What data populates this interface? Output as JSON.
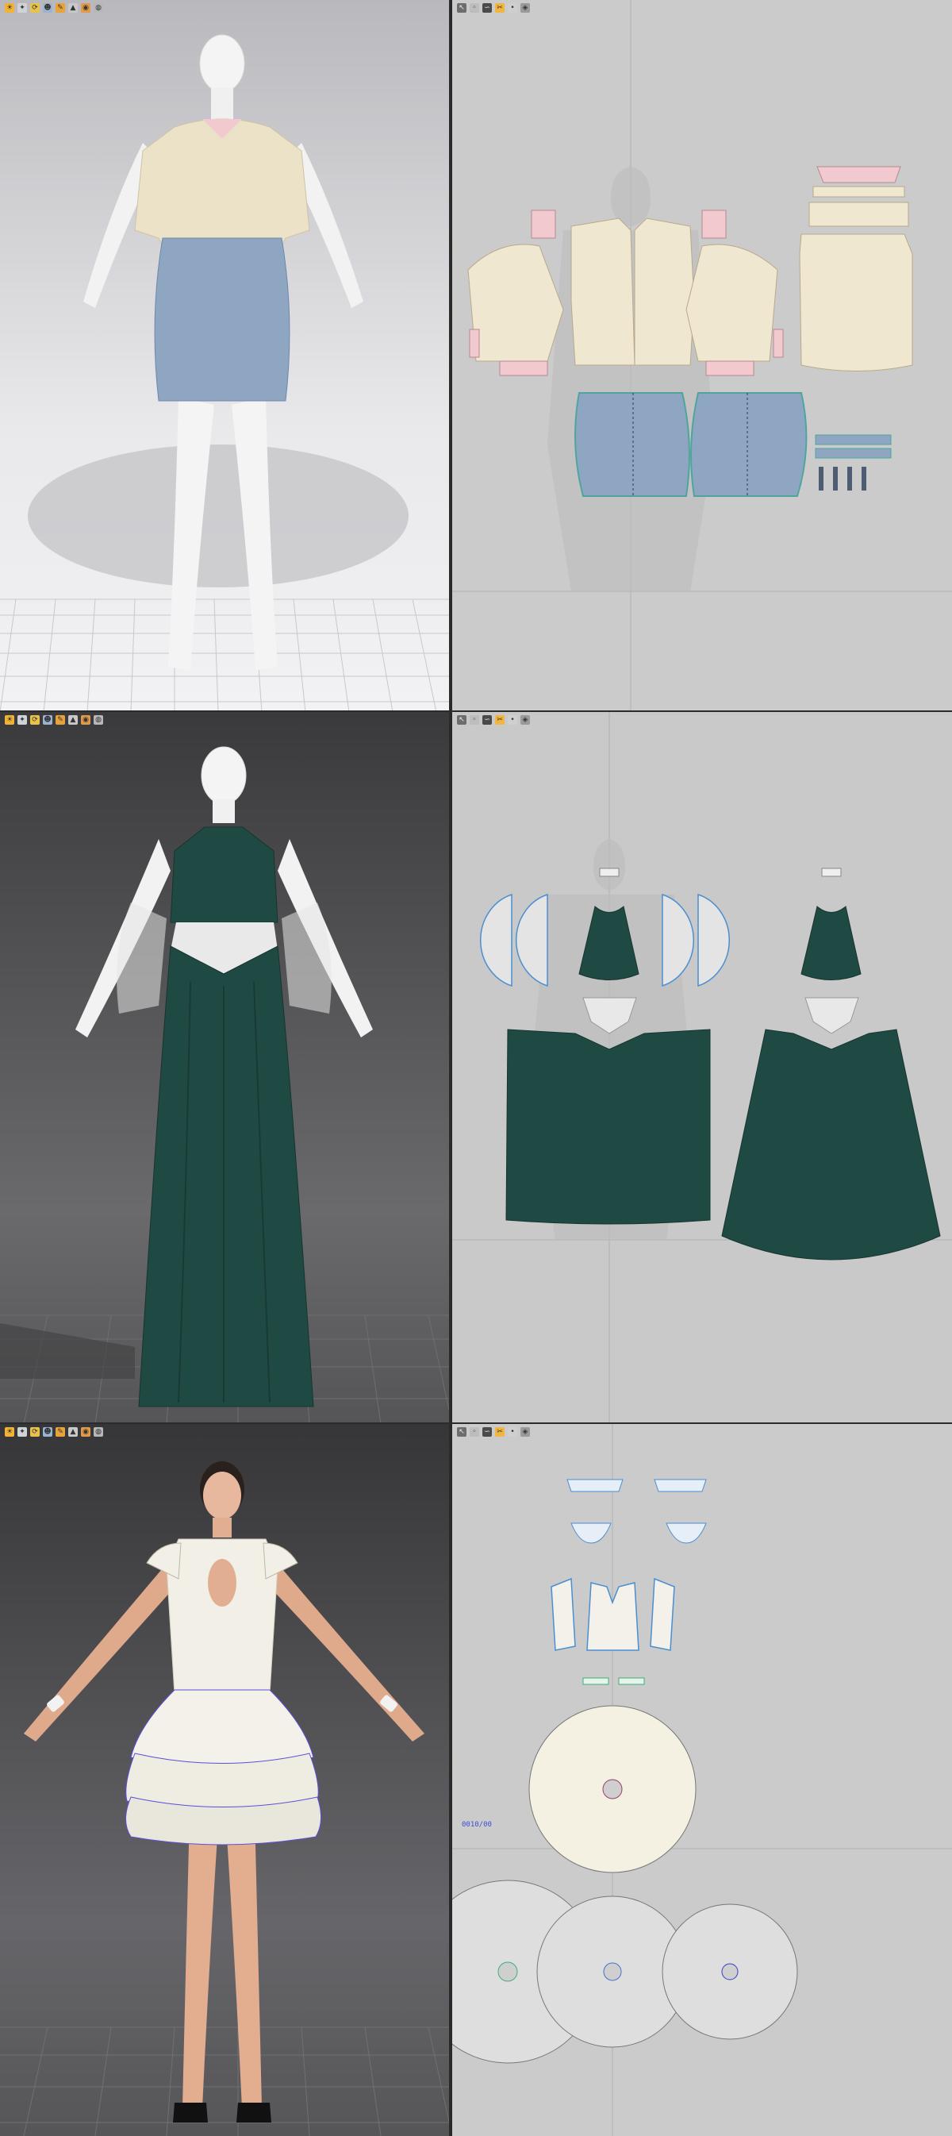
{
  "toolbar3d": {
    "icons": [
      "sun-icon",
      "select-icon",
      "rotate-icon",
      "avatar-icon",
      "measure-icon",
      "brush-icon",
      "camera-icon",
      "render-icon"
    ],
    "glyphs": [
      "☀",
      "✦",
      "⟳",
      "☻",
      "✎",
      "▲",
      "◉",
      "◍"
    ]
  },
  "toolbar2d": {
    "icons": [
      "transform-icon",
      "edit-point-icon",
      "curve-icon",
      "sewing-icon",
      "pin-icon",
      "fold-icon"
    ],
    "glyphs": [
      "↖",
      "◦",
      "∽",
      "✂",
      "•",
      "◈"
    ]
  },
  "workspace": {
    "panel3d_bg_light": "#d8d8d8",
    "panel3d_bg_dark": "#5c5c5c",
    "panel2d_bg": "#c9c9c9",
    "shirt_color": "#ece2c8",
    "skirt_color": "#8fa6c2",
    "velvet_color": "#1f4a44",
    "white_dress_color": "#f1efe6"
  },
  "viewer": {
    "coordinate_label": "0010/00"
  }
}
